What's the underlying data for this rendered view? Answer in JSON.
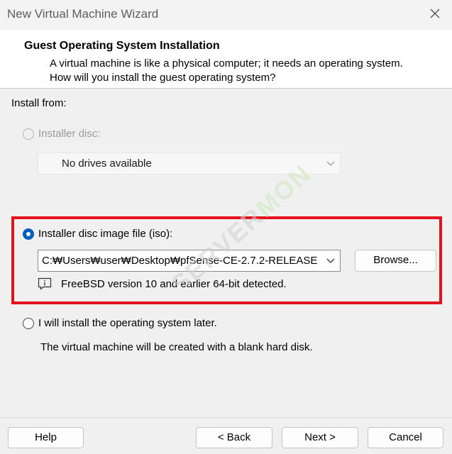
{
  "window": {
    "title": "New Virtual Machine Wizard",
    "close_icon": "close-icon"
  },
  "header": {
    "title": "Guest Operating System Installation",
    "description": "A virtual machine is like a physical computer; it needs an operating system. How will you install the guest operating system?"
  },
  "install_from_label": "Install from:",
  "installer_disc": {
    "label": "Installer disc:",
    "selected": false,
    "enabled": false,
    "drive_value": "No drives available"
  },
  "iso_option": {
    "label": "Installer disc image file (iso):",
    "selected": true,
    "path_value": "C:₩Users₩user₩Desktop₩pfSense-CE-2.7.2-RELEASE",
    "browse_label": "Browse...",
    "detected_message": "FreeBSD version 10 and earlier 64-bit detected."
  },
  "later_option": {
    "label": "I will install the operating system later.",
    "selected": false,
    "note": "The virtual machine will be created with a blank hard disk."
  },
  "footer": {
    "help_label": "Help",
    "back_label": "< Back",
    "next_label": "Next >",
    "cancel_label": "Cancel"
  },
  "colors": {
    "accent": "#005fb8",
    "highlight_border": "#e3121c"
  }
}
